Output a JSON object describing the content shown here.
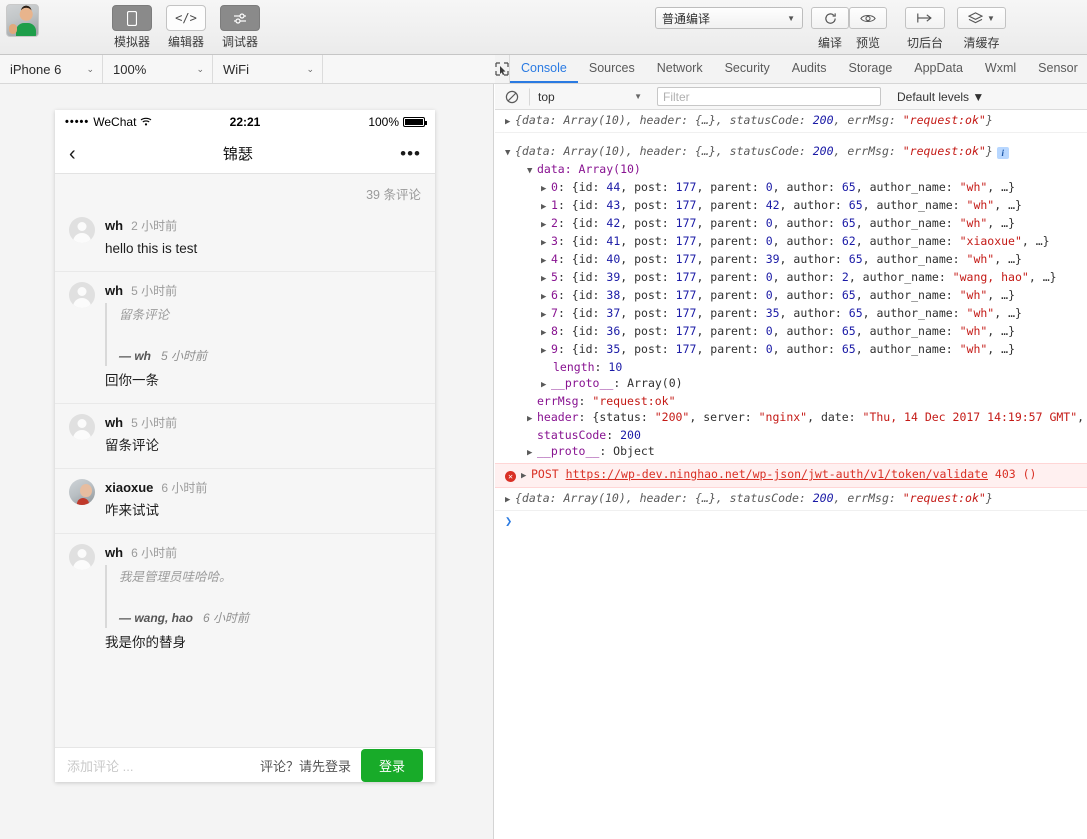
{
  "toolbar": {
    "avatar_name": "user-avatar",
    "buttons": [
      {
        "label": "模拟器",
        "icon": "phone-icon",
        "state": "active"
      },
      {
        "label": "编辑器",
        "icon": "code-icon",
        "state": "inactive"
      },
      {
        "label": "调试器",
        "icon": "sliders-icon",
        "state": "active"
      }
    ],
    "compile_mode": "普通编译",
    "right_actions": [
      {
        "label": "编译",
        "icon": "refresh-icon"
      },
      {
        "label": "预览",
        "icon": "eye-icon"
      },
      {
        "label": "切后台",
        "icon": "background-icon"
      },
      {
        "label": "清缓存",
        "icon": "layers-icon"
      }
    ]
  },
  "devbar": {
    "device": "iPhone 6",
    "zoom": "100%",
    "network": "WiFi"
  },
  "phone": {
    "status": {
      "signal_dots": "•••••",
      "carrier": "WeChat",
      "wifi_icon": "wifi-icon",
      "time": "22:21",
      "battery_percent": "100%"
    },
    "nav": {
      "back_icon": "chevron-left-icon",
      "title": "锦瑟",
      "more_icon": "ellipsis-icon"
    },
    "comment_count": "39 条评论",
    "comments": [
      {
        "author": "wh",
        "time": "2 小时前",
        "avatar": "default-avatar",
        "text": "hello this is test",
        "quote": null
      },
      {
        "author": "wh",
        "time": "5 小时前",
        "avatar": "default-avatar",
        "text": "回你一条",
        "quote": {
          "text": "留条评论",
          "author": "— wh",
          "time": "5 小时前"
        }
      },
      {
        "author": "wh",
        "time": "5 小时前",
        "avatar": "default-avatar",
        "text": "留条评论",
        "quote": null
      },
      {
        "author": "xiaoxue",
        "time": "6 小时前",
        "avatar": "photo-avatar",
        "text": "咋来试试",
        "quote": null
      },
      {
        "author": "wh",
        "time": "6 小时前",
        "avatar": "default-avatar",
        "text": "我是你的替身",
        "quote": {
          "text": "我是管理员哇哈哈。",
          "author": "— wang, hao",
          "time": "6 小时前"
        }
      }
    ],
    "footer": {
      "input_placeholder": "添加评论 ...",
      "login_hint": "评论？请先登录",
      "login_button": "登录",
      "login_color": "#18ab29"
    }
  },
  "devtools": {
    "inspect_icon": "inspect-cursor-icon",
    "tabs": [
      {
        "label": "Console",
        "active": true
      },
      {
        "label": "Sources",
        "active": false
      },
      {
        "label": "Network",
        "active": false
      },
      {
        "label": "Security",
        "active": false
      },
      {
        "label": "Audits",
        "active": false
      },
      {
        "label": "Storage",
        "active": false
      },
      {
        "label": "AppData",
        "active": false
      },
      {
        "label": "Wxml",
        "active": false
      },
      {
        "label": "Sensor",
        "active": false
      }
    ],
    "filterbar": {
      "clear_icon": "clear-console-icon",
      "context": "top",
      "filter_placeholder": "Filter",
      "levels": "Default levels ▼"
    },
    "console": {
      "summary_line": {
        "prefix": "{data: Array(10), header: {…}, statusCode: ",
        "status": "200",
        "mid": ", errMsg: ",
        "errmsg": "\"request:ok\"",
        "suffix": "}"
      },
      "data_label": "data: Array(10)",
      "array_items": [
        {
          "index": "0",
          "id": "44",
          "post": "177",
          "parent": "0",
          "author": "65",
          "author_name": "\"wh\""
        },
        {
          "index": "1",
          "id": "43",
          "post": "177",
          "parent": "42",
          "author": "65",
          "author_name": "\"wh\""
        },
        {
          "index": "2",
          "id": "42",
          "post": "177",
          "parent": "0",
          "author": "65",
          "author_name": "\"wh\""
        },
        {
          "index": "3",
          "id": "41",
          "post": "177",
          "parent": "0",
          "author": "62",
          "author_name": "\"xiaoxue\""
        },
        {
          "index": "4",
          "id": "40",
          "post": "177",
          "parent": "39",
          "author": "65",
          "author_name": "\"wh\""
        },
        {
          "index": "5",
          "id": "39",
          "post": "177",
          "parent": "0",
          "author": "2",
          "author_name": "\"wang, hao\""
        },
        {
          "index": "6",
          "id": "38",
          "post": "177",
          "parent": "0",
          "author": "65",
          "author_name": "\"wh\""
        },
        {
          "index": "7",
          "id": "37",
          "post": "177",
          "parent": "35",
          "author": "65",
          "author_name": "\"wh\""
        },
        {
          "index": "8",
          "id": "36",
          "post": "177",
          "parent": "0",
          "author": "65",
          "author_name": "\"wh\""
        },
        {
          "index": "9",
          "id": "35",
          "post": "177",
          "parent": "0",
          "author": "65",
          "author_name": "\"wh\""
        }
      ],
      "length_key": "length",
      "length_value": "10",
      "proto_array": "__proto__",
      "proto_array_value": "Array(0)",
      "errmsg_key": "errMsg",
      "errmsg_value": "\"request:ok\"",
      "header_key": "header",
      "header_status_key": "status",
      "header_status": "\"200\"",
      "header_server_key": "server",
      "header_server": "\"nginx\"",
      "header_date_key": "date",
      "header_date": "\"Thu, 14 Dec 2017 14:19:57 GMT\"",
      "header_tail": ", con",
      "statuscode_key": "statusCode",
      "statuscode_value": "200",
      "proto_obj": "__proto__",
      "proto_obj_value": "Object",
      "error": {
        "method": "POST",
        "url": "https://wp-dev.ninghao.net/wp-json/jwt-auth/v1/token/validate",
        "status": "403 ()"
      },
      "prompt": "❯"
    }
  }
}
